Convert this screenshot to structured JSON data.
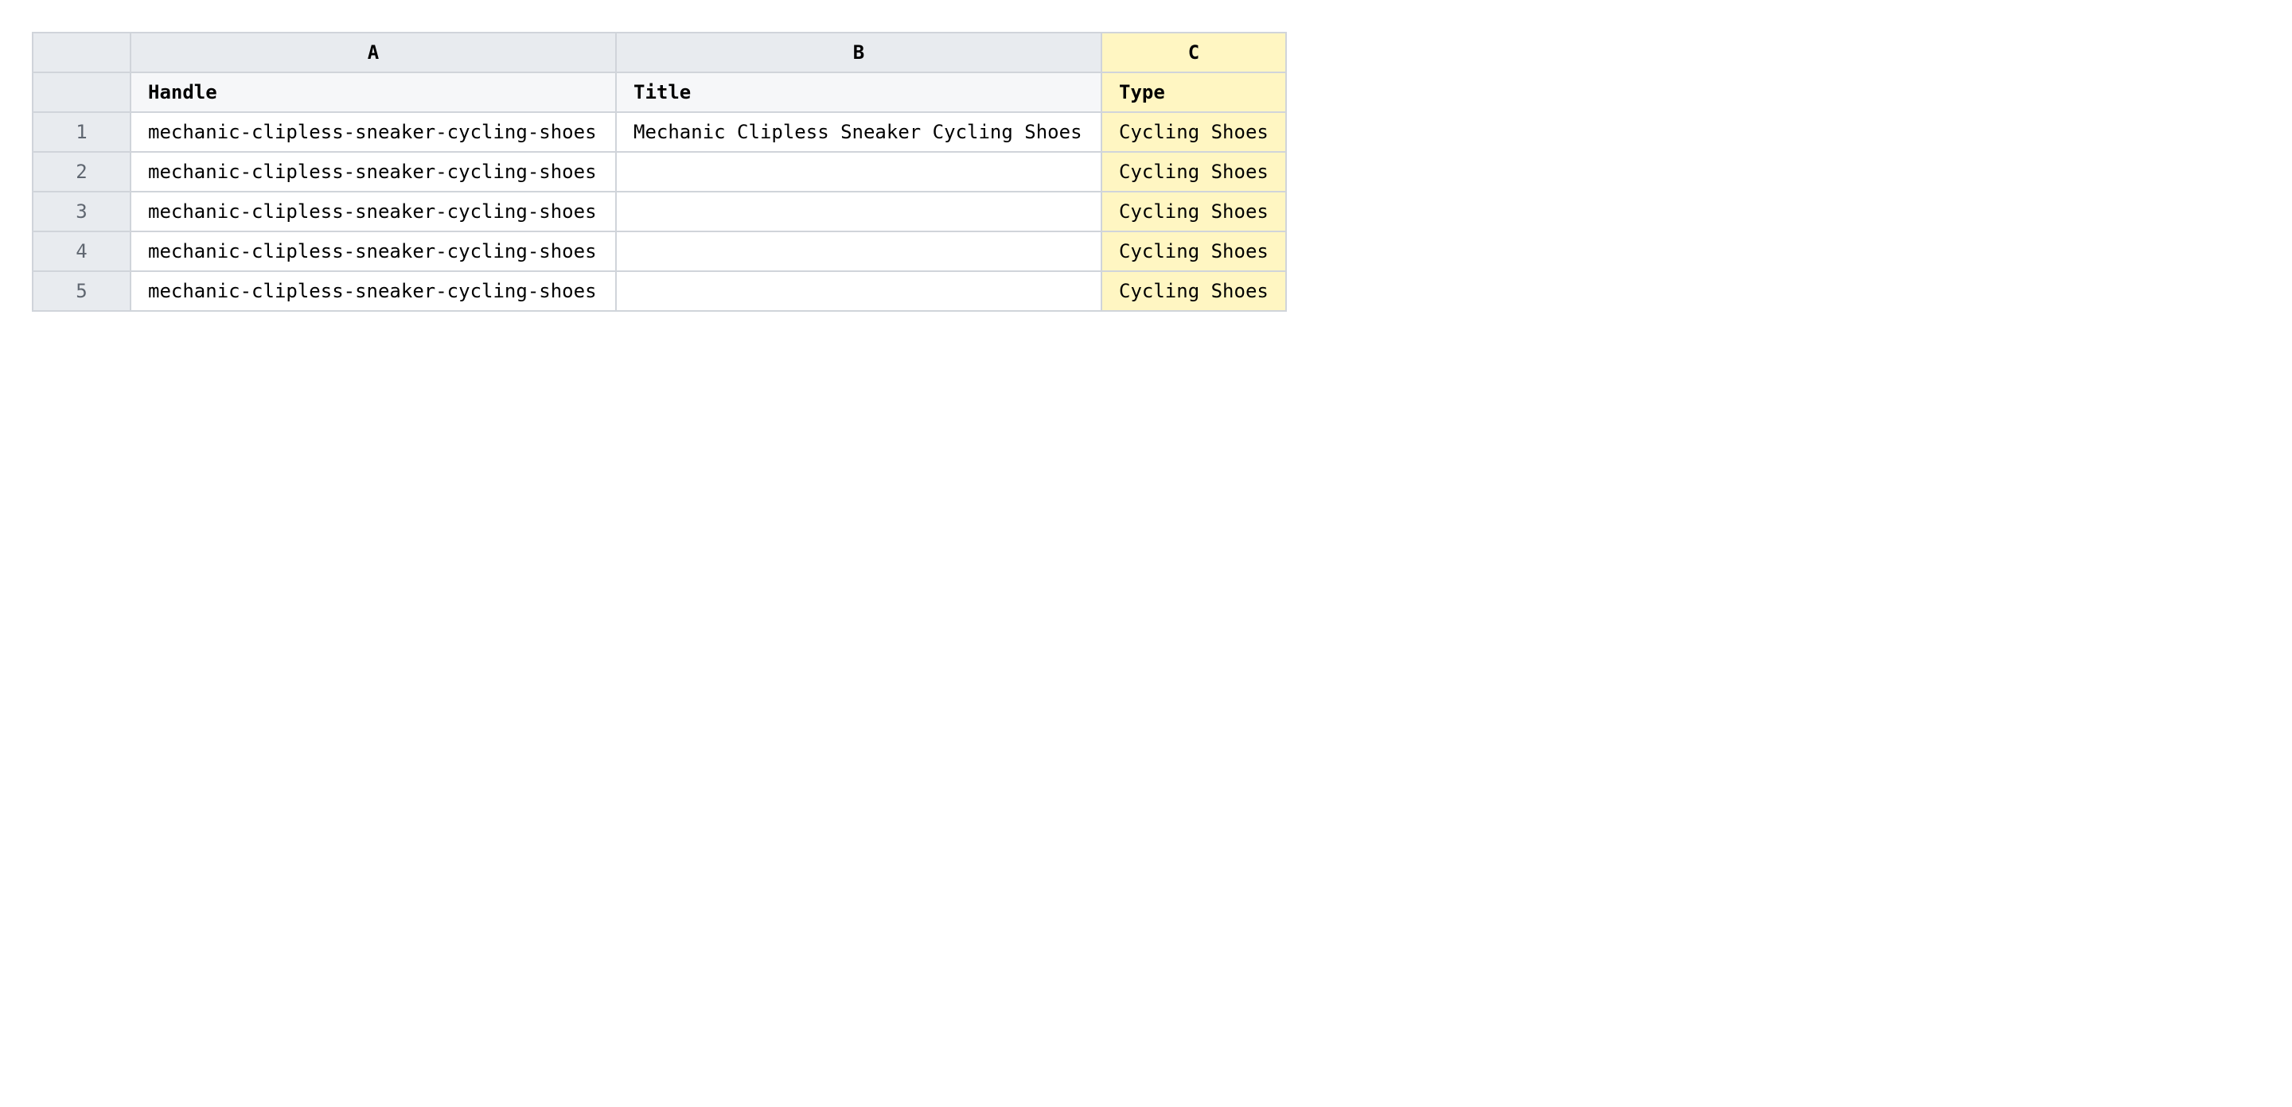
{
  "sheet": {
    "columns": [
      "A",
      "B",
      "C"
    ],
    "highlight_color": "#fff6c2",
    "highlighted_column": "C",
    "headers": [
      "Handle",
      "Title",
      "Type"
    ],
    "rows": [
      {
        "num": "1",
        "handle": "mechanic-clipless-sneaker-cycling-shoes",
        "title": "Mechanic Clipless Sneaker Cycling Shoes",
        "type": "Cycling Shoes"
      },
      {
        "num": "2",
        "handle": "mechanic-clipless-sneaker-cycling-shoes",
        "title": "",
        "type": "Cycling Shoes"
      },
      {
        "num": "3",
        "handle": "mechanic-clipless-sneaker-cycling-shoes",
        "title": "",
        "type": "Cycling Shoes"
      },
      {
        "num": "4",
        "handle": "mechanic-clipless-sneaker-cycling-shoes",
        "title": "",
        "type": "Cycling Shoes"
      },
      {
        "num": "5",
        "handle": "mechanic-clipless-sneaker-cycling-shoes",
        "title": "",
        "type": "Cycling Shoes"
      }
    ]
  }
}
